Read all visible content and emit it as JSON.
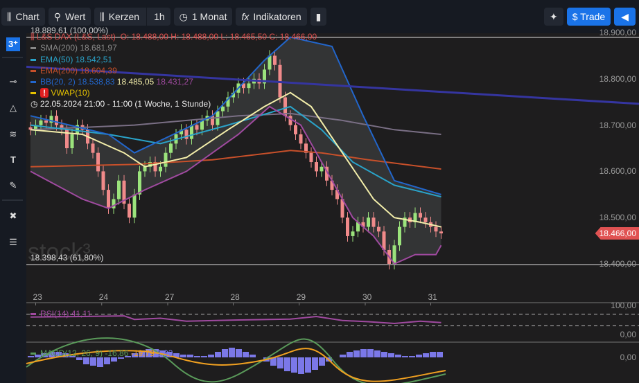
{
  "toolbar": {
    "chart": "Chart",
    "wert": "Wert",
    "kerzen": "Kerzen",
    "interval": "1h",
    "period": "1 Monat",
    "indikatoren": "Indikatoren",
    "trade": "$ Trade"
  },
  "sidebar": {
    "logo": "3⁺",
    "icons": [
      "slider-icon",
      "triangle-icon",
      "pattern-icon",
      "text-icon",
      "pen-icon",
      "tools-icon",
      "layout-icon"
    ]
  },
  "legend": {
    "fib_top": "18.889,61 (100,00%)",
    "fib_bottom": "18.398,43 (61,80%)",
    "instrument": "L&S DAX (L&S, Last)",
    "ohlc": "O: 18.488,00  H: 18.488,00  L: 18.465,50  C: 18.466,00",
    "sma": "SMA(200)",
    "sma_val": "18.681,97",
    "ema50": "EMA(50)",
    "ema50_val": "18.542,51",
    "ema200": "EMA(200)",
    "ema200_val": "18.604,39",
    "bb": "BB(20, 2)",
    "bb_upper": "18.538,83",
    "bb_mid": "18.485,05",
    "bb_lower": "18.431,27",
    "vwap": "VWAP(10)",
    "range": "22.05.2024 21:00 - 11:00   (1 Woche, 1 Stunde)",
    "rsi": "RSI(14)",
    "rsi_val": "41,11",
    "macd": "MACD(12, 26, 9)",
    "macd_val": "-16,86",
    "macd_sig": "-19,79",
    "macd_hist": "2,93"
  },
  "watermark": "stock³",
  "colors": {
    "up": "#9be37c",
    "down": "#f08a8a",
    "bb": "#2266cc",
    "bbLow": "#a04aa0",
    "sma": "#7a6f85",
    "ema50": "#2aa3c9",
    "ema200": "#c8502a",
    "vwap": "#f3eeaa",
    "trend": "#3535a0",
    "rsi": "#a04aa0",
    "macd": "#5a9a5a",
    "signal": "#f0a020",
    "hist": "#7b78e8"
  },
  "chart_data": {
    "type": "candlestick",
    "ylim": [
      18300,
      18920
    ],
    "y_ticks": [
      "18.900,00",
      "18.800,00",
      "18.700,00",
      "18.600,00",
      "18.500,00",
      "18.400,00"
    ],
    "y_tick_values": [
      18900,
      18800,
      18700,
      18600,
      18500,
      18400
    ],
    "current_price": "18.466,00",
    "current_value": 18466,
    "fib_values": [
      18889.61,
      18398.43
    ],
    "days": [
      {
        "label": "23",
        "index": 1
      },
      {
        "label": "24",
        "index": 13.7
      },
      {
        "label": "27",
        "index": 26.4
      },
      {
        "label": "28",
        "index": 39
      },
      {
        "label": "29",
        "index": 51.7
      },
      {
        "label": "30",
        "index": 64.4
      },
      {
        "label": "31",
        "index": 77
      }
    ],
    "closes": [
      18690,
      18700,
      18710,
      18705,
      18720,
      18700,
      18690,
      18650,
      18680,
      18700,
      18690,
      18660,
      18640,
      18600,
      18560,
      18520,
      18540,
      18580,
      18530,
      18500,
      18550,
      18600,
      18610,
      18620,
      18600,
      18610,
      18640,
      18660,
      18680,
      18690,
      18670,
      18700,
      18690,
      18710,
      18720,
      18700,
      18730,
      18740,
      18760,
      18770,
      18790,
      18780,
      18790,
      18800,
      18790,
      18820,
      18850,
      18830,
      18760,
      18720,
      18700,
      18680,
      18660,
      18640,
      18620,
      18600,
      18610,
      18580,
      18560,
      18540,
      18500,
      18460,
      18470,
      18490,
      18480,
      18500,
      18480,
      18470,
      18430,
      18400,
      18440,
      18480,
      18500,
      18490,
      18510,
      18500,
      18490,
      18480,
      18470,
      18466
    ],
    "bb_upper": [
      [
        0,
        18720
      ],
      [
        15,
        18680
      ],
      [
        20,
        18640
      ],
      [
        35,
        18720
      ],
      [
        45,
        18840
      ],
      [
        50,
        18890
      ],
      [
        58,
        18870
      ],
      [
        64,
        18720
      ],
      [
        70,
        18580
      ],
      [
        79,
        18550
      ]
    ],
    "bb_lower": [
      [
        0,
        18600
      ],
      [
        10,
        18540
      ],
      [
        15,
        18520
      ],
      [
        22,
        18560
      ],
      [
        30,
        18600
      ],
      [
        40,
        18680
      ],
      [
        46,
        18740
      ],
      [
        52,
        18700
      ],
      [
        56,
        18620
      ],
      [
        62,
        18500
      ],
      [
        66,
        18460
      ],
      [
        70,
        18400
      ],
      [
        74,
        18420
      ],
      [
        78,
        18420
      ],
      [
        79,
        18440
      ]
    ],
    "vwap": [
      [
        0,
        18690
      ],
      [
        10,
        18680
      ],
      [
        18,
        18640
      ],
      [
        22,
        18610
      ],
      [
        30,
        18630
      ],
      [
        38,
        18690
      ],
      [
        45,
        18740
      ],
      [
        50,
        18770
      ],
      [
        54,
        18740
      ],
      [
        60,
        18640
      ],
      [
        66,
        18540
      ],
      [
        70,
        18500
      ],
      [
        75,
        18490
      ],
      [
        79,
        18480
      ]
    ],
    "ema50": [
      [
        0,
        18700
      ],
      [
        15,
        18680
      ],
      [
        25,
        18660
      ],
      [
        38,
        18700
      ],
      [
        50,
        18740
      ],
      [
        56,
        18690
      ],
      [
        62,
        18620
      ],
      [
        70,
        18570
      ],
      [
        79,
        18545
      ]
    ],
    "ema200": [
      [
        0,
        18610
      ],
      [
        20,
        18615
      ],
      [
        35,
        18625
      ],
      [
        50,
        18645
      ],
      [
        56,
        18640
      ],
      [
        65,
        18625
      ],
      [
        79,
        18605
      ]
    ],
    "sma200": [
      [
        0,
        18690
      ],
      [
        20,
        18700
      ],
      [
        40,
        18720
      ],
      [
        50,
        18725
      ],
      [
        60,
        18710
      ],
      [
        70,
        18690
      ],
      [
        79,
        18680
      ]
    ],
    "trendline": [
      18826,
      18746
    ],
    "rsi": {
      "ticks": [
        "100,00",
        "0,00"
      ],
      "series": [
        [
          0,
          60
        ],
        [
          10,
          62
        ],
        [
          18,
          64
        ],
        [
          20,
          52
        ],
        [
          25,
          56
        ],
        [
          30,
          46
        ],
        [
          40,
          50
        ],
        [
          50,
          53
        ],
        [
          55,
          62
        ],
        [
          60,
          48
        ],
        [
          65,
          44
        ],
        [
          70,
          38
        ],
        [
          75,
          46
        ],
        [
          79,
          41
        ]
      ]
    },
    "macd": {
      "tick": "0,00",
      "hist": [
        2,
        4,
        6,
        8,
        8,
        6,
        2,
        -4,
        -10,
        -12,
        -14,
        -10,
        -6,
        -2,
        2,
        6,
        10,
        12,
        12,
        10,
        8,
        6,
        4,
        4,
        2,
        2,
        4,
        8,
        12,
        14,
        12,
        8,
        4,
        0,
        -6,
        -12,
        -16,
        -20,
        -22,
        -24,
        -22,
        -18,
        -12,
        -6,
        0,
        4,
        8,
        10,
        12,
        12,
        10,
        8,
        6,
        4,
        2,
        2,
        4,
        6,
        8,
        8
      ]
    }
  }
}
